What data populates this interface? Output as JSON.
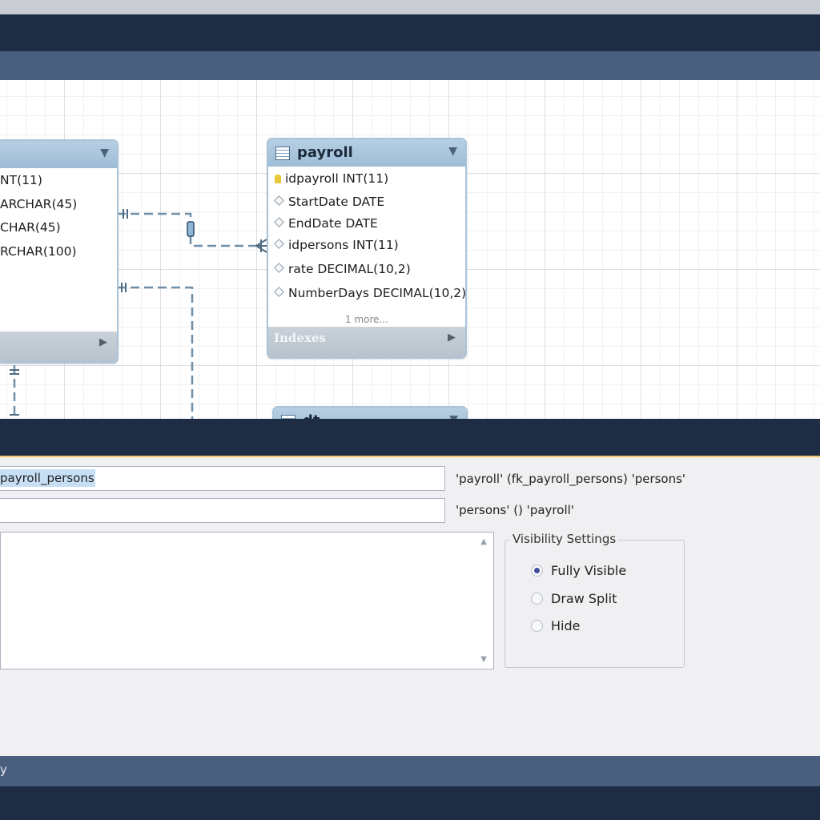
{
  "persons_table": {
    "columns": [
      "NT(11)",
      "ARCHAR(45)",
      "CHAR(45)",
      "RCHAR(100)"
    ]
  },
  "payroll_table": {
    "name": "payroll",
    "columns": [
      "idpayroll INT(11)",
      "StartDate DATE",
      "EndDate DATE",
      "idpersons INT(11)",
      "rate DECIMAL(10,2)",
      "NumberDays DECIMAL(10,2)"
    ],
    "more": "1 more...",
    "indexes_label": "Indexes"
  },
  "third_table": {
    "name": "dt"
  },
  "relationship": {
    "name_value": "payroll_persons",
    "caption": "'payroll'  (fk_payroll_persons)  'persons'",
    "second_value": "",
    "second_caption": "'persons' () 'payroll'"
  },
  "visibility": {
    "title": "Visibility Settings",
    "options": [
      "Fully Visible",
      "Draw Split",
      "Hide"
    ],
    "selected": "Fully Visible"
  },
  "status": {
    "text": "y"
  },
  "colors": {
    "accent": "#f2c66a",
    "chrome_dark": "#1e2c44",
    "chrome_mid": "#4a5f7d",
    "table_header": "#a9c3d9"
  }
}
